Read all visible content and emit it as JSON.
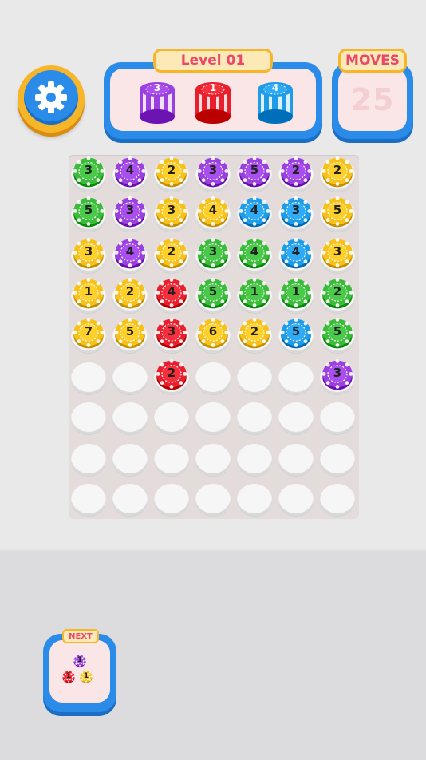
{
  "header": {
    "level_label": "Level 01",
    "moves_label": "MOVES",
    "moves_value": "25"
  },
  "targets": [
    {
      "value": "3",
      "color": "purple"
    },
    {
      "value": "1",
      "color": "red"
    },
    {
      "value": "4",
      "color": "blue"
    }
  ],
  "colors": {
    "yellow": "#f7c11a",
    "purple": "#9a3fe0",
    "red": "#e81f2c",
    "green": "#3bbb3a",
    "blue": "#1e9ce8",
    "accent_blue": "#2a8be8",
    "accent_orange": "#f7b52a",
    "title_pink": "#e9476b"
  },
  "board": {
    "columns": 7,
    "rows": 9,
    "chips": [
      {
        "row": 0,
        "col": 0,
        "color": "green",
        "value": "3"
      },
      {
        "row": 0,
        "col": 1,
        "color": "purple",
        "value": "4"
      },
      {
        "row": 0,
        "col": 2,
        "color": "yellow",
        "value": "2"
      },
      {
        "row": 0,
        "col": 3,
        "color": "purple",
        "value": "3"
      },
      {
        "row": 0,
        "col": 4,
        "color": "purple",
        "value": "5"
      },
      {
        "row": 0,
        "col": 5,
        "color": "purple",
        "value": "2"
      },
      {
        "row": 0,
        "col": 6,
        "color": "yellow",
        "value": "2"
      },
      {
        "row": 1,
        "col": 0,
        "color": "green",
        "value": "5"
      },
      {
        "row": 1,
        "col": 1,
        "color": "purple",
        "value": "3"
      },
      {
        "row": 1,
        "col": 2,
        "color": "yellow",
        "value": "3"
      },
      {
        "row": 1,
        "col": 3,
        "color": "yellow",
        "value": "4"
      },
      {
        "row": 1,
        "col": 4,
        "color": "blue",
        "value": "4"
      },
      {
        "row": 1,
        "col": 5,
        "color": "blue",
        "value": "3"
      },
      {
        "row": 1,
        "col": 6,
        "color": "yellow",
        "value": "5"
      },
      {
        "row": 2,
        "col": 0,
        "color": "yellow",
        "value": "3"
      },
      {
        "row": 2,
        "col": 1,
        "color": "purple",
        "value": "4"
      },
      {
        "row": 2,
        "col": 2,
        "color": "yellow",
        "value": "2"
      },
      {
        "row": 2,
        "col": 3,
        "color": "green",
        "value": "3"
      },
      {
        "row": 2,
        "col": 4,
        "color": "green",
        "value": "4"
      },
      {
        "row": 2,
        "col": 5,
        "color": "blue",
        "value": "4"
      },
      {
        "row": 2,
        "col": 6,
        "color": "yellow",
        "value": "3"
      },
      {
        "row": 3,
        "col": 0,
        "color": "yellow",
        "value": "1"
      },
      {
        "row": 3,
        "col": 1,
        "color": "yellow",
        "value": "2"
      },
      {
        "row": 3,
        "col": 2,
        "color": "red",
        "value": "4"
      },
      {
        "row": 3,
        "col": 3,
        "color": "green",
        "value": "5"
      },
      {
        "row": 3,
        "col": 4,
        "color": "green",
        "value": "1"
      },
      {
        "row": 3,
        "col": 5,
        "color": "green",
        "value": "1"
      },
      {
        "row": 3,
        "col": 6,
        "color": "green",
        "value": "2"
      },
      {
        "row": 4,
        "col": 0,
        "color": "yellow",
        "value": "7"
      },
      {
        "row": 4,
        "col": 1,
        "color": "yellow",
        "value": "5"
      },
      {
        "row": 4,
        "col": 2,
        "color": "red",
        "value": "3"
      },
      {
        "row": 4,
        "col": 3,
        "color": "yellow",
        "value": "6"
      },
      {
        "row": 4,
        "col": 4,
        "color": "yellow",
        "value": "2"
      },
      {
        "row": 4,
        "col": 5,
        "color": "blue",
        "value": "5"
      },
      {
        "row": 4,
        "col": 6,
        "color": "green",
        "value": "5"
      },
      {
        "row": 5,
        "col": 2,
        "color": "red",
        "value": "2"
      },
      {
        "row": 5,
        "col": 6,
        "color": "purple",
        "value": "3"
      }
    ]
  },
  "next": {
    "label": "NEXT",
    "chips": [
      {
        "color": "purple",
        "value": "1"
      },
      {
        "color": "red",
        "value": "1"
      },
      {
        "color": "yellow",
        "value": "1"
      }
    ]
  }
}
